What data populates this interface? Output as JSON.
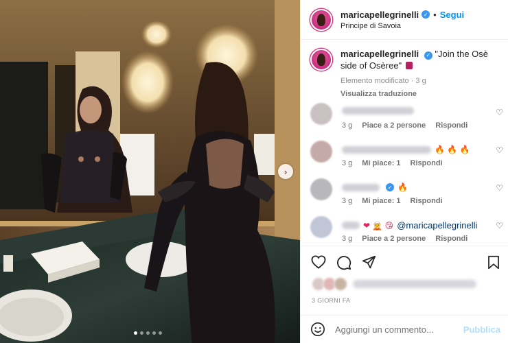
{
  "post": {
    "username": "maricapellegrinelli",
    "follow_label": "Segui",
    "separator": "•",
    "location": "Principe di Savoia",
    "caption_text": "\"Join the Osè side of Osèree\"",
    "edited_label": "Elemento modificato · 3 g",
    "translate_label": "Visualizza traduzione",
    "date_label": "3 GIORNI FA",
    "carousel_dots": 5,
    "carousel_active": 0
  },
  "comments": [
    {
      "time": "3 g",
      "likes": "Piace a 2 persone",
      "reply": "Rispondi",
      "emoji": "",
      "mention": ""
    },
    {
      "time": "3 g",
      "likes": "Mi piace: 1",
      "reply": "Rispondi",
      "emoji": "🔥 🔥 🔥",
      "mention": ""
    },
    {
      "time": "3 g",
      "likes": "Mi piace: 1",
      "reply": "Rispondi",
      "emoji": "🔥",
      "mention": ""
    },
    {
      "time": "3 g",
      "likes": "Piace a 2 persone",
      "reply": "Rispondi",
      "emoji": "❤ 🧝 😘",
      "mention": "@maricapellegrinelli"
    }
  ],
  "composer": {
    "placeholder": "Aggiungi un commento...",
    "publish_label": "Pubblica"
  },
  "icons": {
    "verified": "verified-badge-icon",
    "heart": "heart-icon",
    "comment": "comment-icon",
    "share": "share-icon",
    "save": "bookmark-icon",
    "emoji": "emoji-icon",
    "next": "chevron-right-icon"
  },
  "colors": {
    "accent": "#0095f6",
    "publish_disabled": "#b2dffc",
    "muted": "#8e8e8e"
  }
}
